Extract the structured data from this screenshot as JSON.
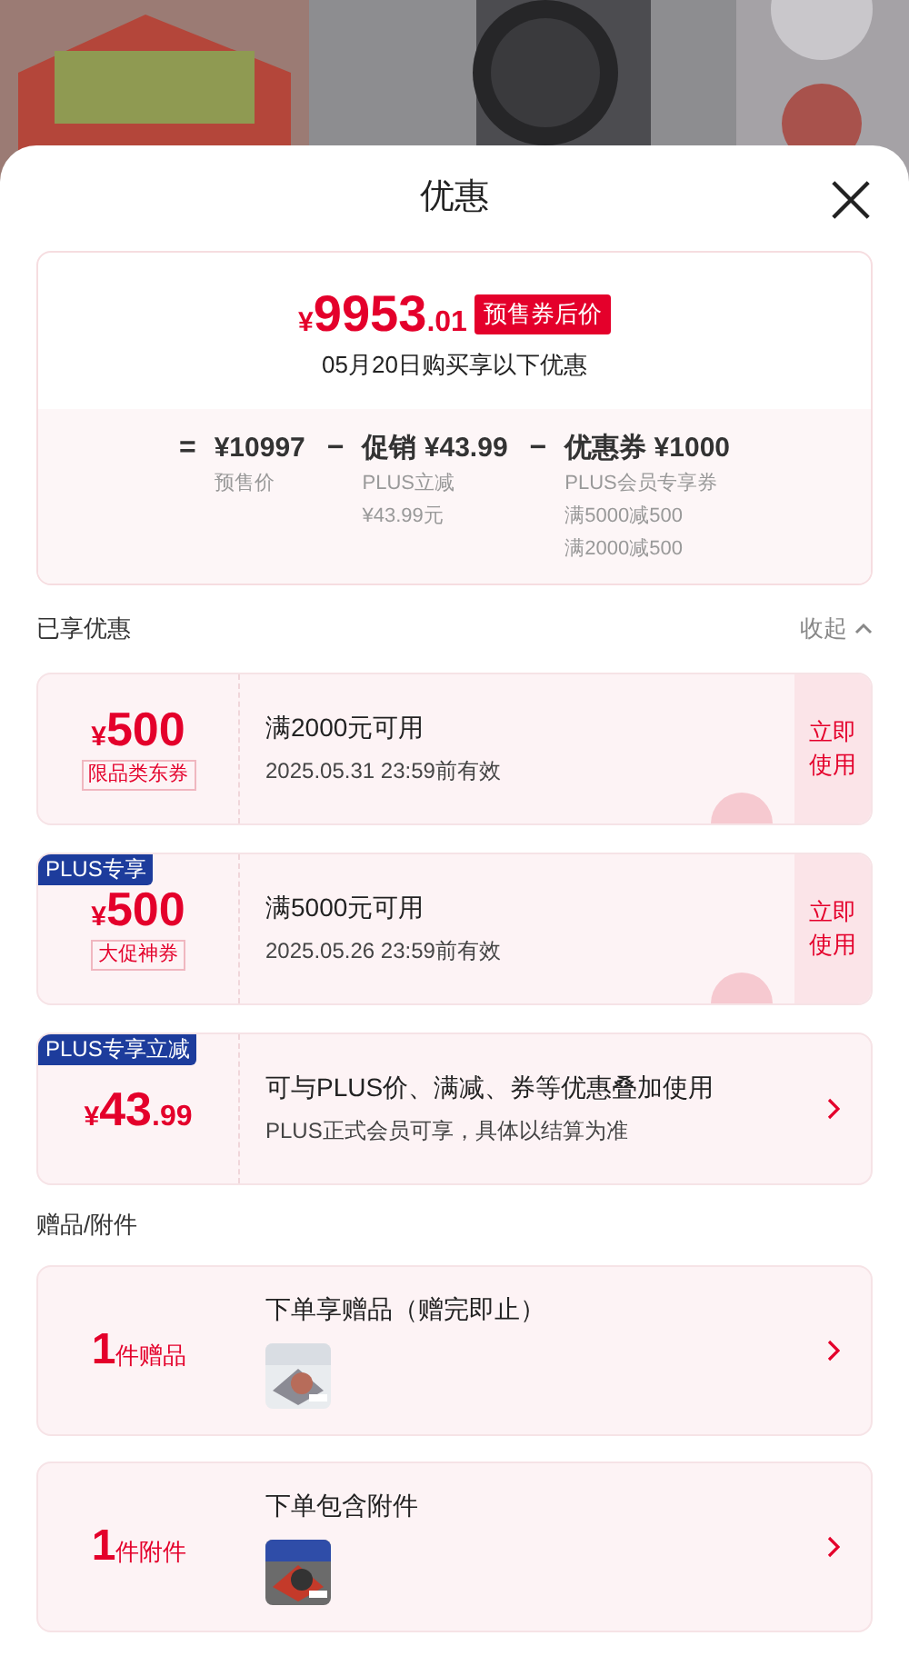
{
  "sheet": {
    "title": "优惠"
  },
  "summary": {
    "price": {
      "currency": "¥",
      "integer": "9953",
      "decimal": ".01"
    },
    "badge": "预售券后价",
    "subtitle": "05月20日购买享以下优惠",
    "formula": [
      {
        "op": "=",
        "amount": "¥10997",
        "notes": [
          "预售价"
        ]
      },
      {
        "op": "−",
        "amount": "促销 ¥43.99",
        "notes": [
          "PLUS立减",
          "¥43.99元"
        ]
      },
      {
        "op": "−",
        "amount": "优惠券 ¥1000",
        "notes": [
          "PLUS会员专享券",
          "满5000减500",
          "满2000减500"
        ]
      }
    ]
  },
  "applied": {
    "title": "已享优惠",
    "toggle": "收起",
    "expanded": true,
    "items": [
      {
        "kind": "coupon",
        "amount": {
          "currency": "¥",
          "integer": "500"
        },
        "tag": "限品类东券",
        "title": "满2000元可用",
        "subtitle": "2025.05.31 23:59前有效",
        "action": "立即使用",
        "claimed": true
      },
      {
        "kind": "coupon",
        "badge": "PLUS专享",
        "amount": {
          "currency": "¥",
          "integer": "500"
        },
        "tag": "大促神券",
        "title": "满5000元可用",
        "subtitle": "2025.05.26 23:59前有效",
        "action": "立即使用",
        "claimed": true
      },
      {
        "kind": "discount",
        "badge": "PLUS专享立减",
        "amount": {
          "currency": "¥",
          "integer": "43",
          "decimal": ".99"
        },
        "title": "可与PLUS价、满减、券等优惠叠加使用",
        "subtitle": "PLUS正式会员可享，具体以结算为准"
      }
    ]
  },
  "gifts": {
    "title": "赠品/附件",
    "items": [
      {
        "count": "1",
        "unit": "件赠品",
        "title": "下单享赠品（赠完即止）"
      },
      {
        "count": "1",
        "unit": "件附件",
        "title": "下单包含附件"
      }
    ]
  }
}
